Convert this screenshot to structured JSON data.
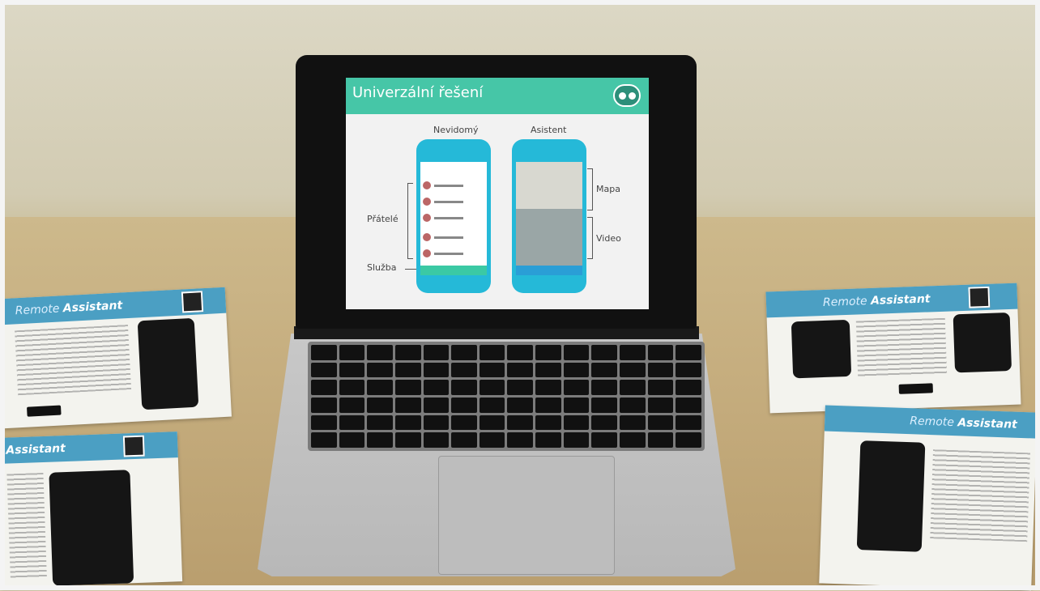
{
  "slide": {
    "title": "Univerzální řešení",
    "col_left": "Nevidomý",
    "col_right": "Asistent",
    "label_friends": "Přátelé",
    "label_service": "Služba",
    "label_map": "Mapa",
    "label_video": "Video"
  },
  "flyer": {
    "brand_prefix": "Remote",
    "brand_name": "Assistant"
  },
  "colors": {
    "slide_accent": "#46c6a7",
    "phone_body": "#25b9d8",
    "flyer_header": "#4b9fc3"
  },
  "icons": [
    "eyes-logo-icon",
    "qr-code-icon"
  ]
}
